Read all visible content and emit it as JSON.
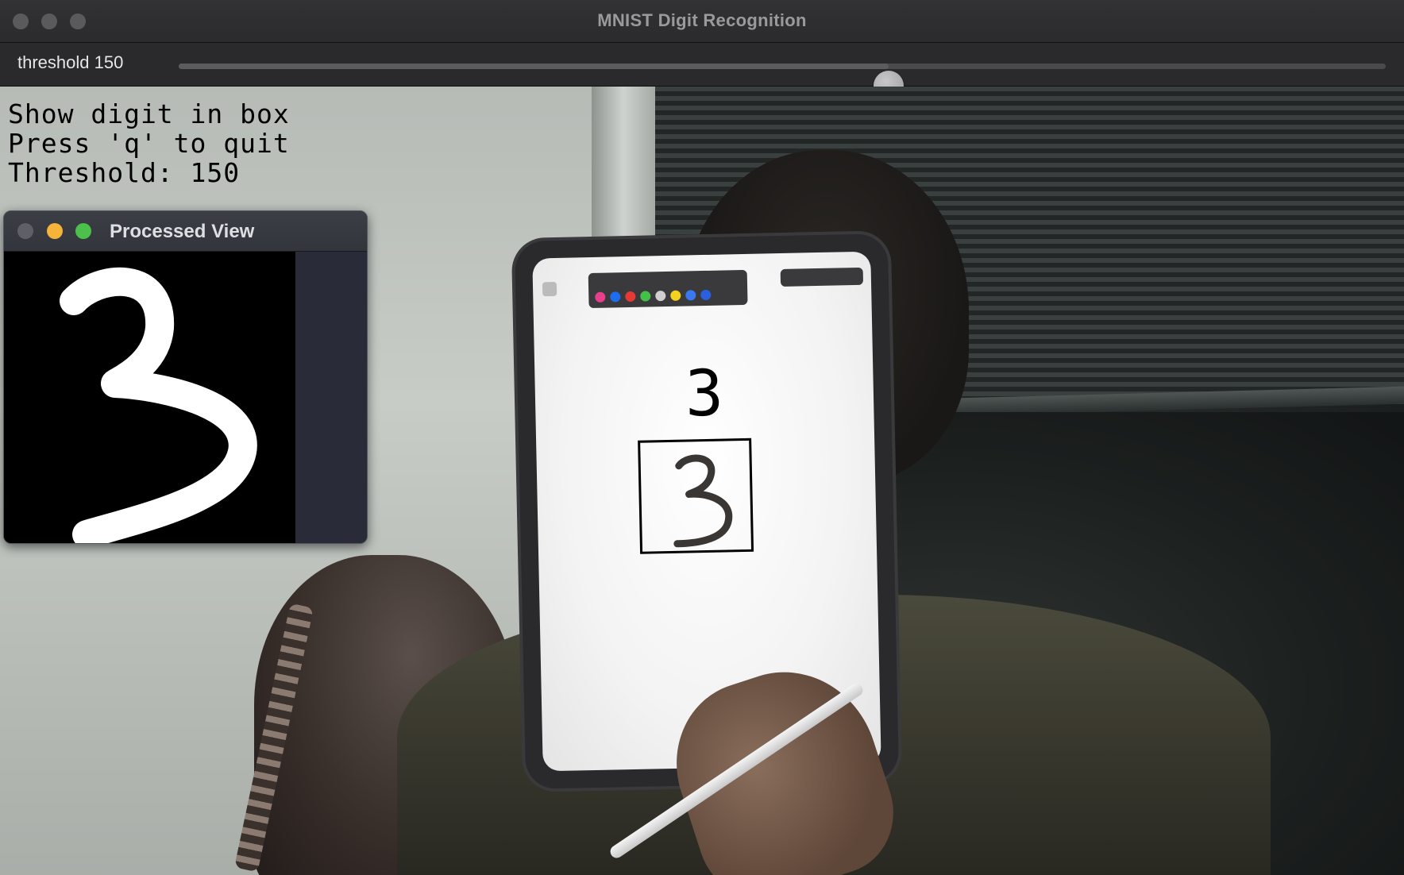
{
  "window": {
    "title": "MNIST Digit Recognition"
  },
  "trackbar": {
    "label": "threshold 150",
    "value": 150,
    "max": 255
  },
  "overlay": {
    "lines": [
      "Show digit in box",
      "Press 'q' to quit",
      "Threshold: 150"
    ]
  },
  "prediction": {
    "digit": "3"
  },
  "processed_view": {
    "title": "Processed View"
  },
  "colors": {
    "thumb": "#b4b4b6",
    "minimize": "#f6b33a",
    "maximize": "#4cc04a",
    "ipad_palette": [
      "#e83e8c",
      "#1e6cf0",
      "#e53935",
      "#43c04a",
      "#cfcfcf",
      "#f3d21f",
      "#3a78f2",
      "#2a5fe0"
    ]
  },
  "icons": [
    "close-icon",
    "minimize-icon",
    "maximize-icon",
    "slider-thumb-icon"
  ]
}
